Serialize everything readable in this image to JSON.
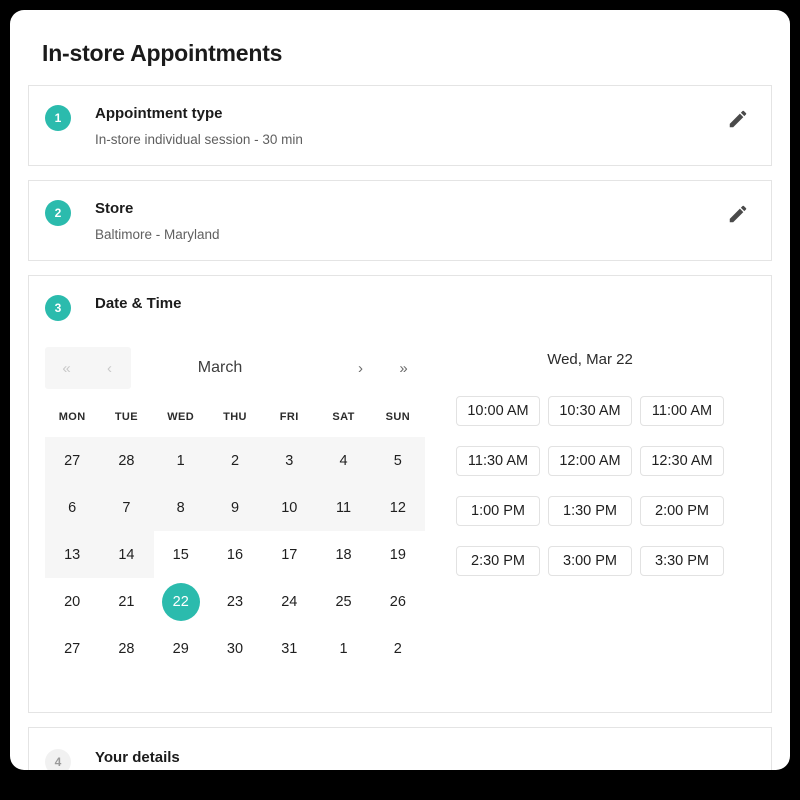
{
  "page": {
    "title": "In-store Appointments"
  },
  "steps": [
    {
      "number": "1",
      "label": "Appointment type",
      "value": "In-store individual session - 30 min",
      "edit_icon": "pencil-icon"
    },
    {
      "number": "2",
      "label": "Store",
      "value": "Baltimore - Maryland",
      "edit_icon": "pencil-icon"
    },
    {
      "number": "3",
      "label": "Date & Time"
    },
    {
      "number": "4",
      "label": "Your details"
    }
  ],
  "calendar": {
    "month": "March",
    "nav": {
      "first": "«",
      "prev": "‹",
      "next": "›",
      "last": "»"
    },
    "weekdays": [
      "MON",
      "TUE",
      "WED",
      "THU",
      "FRI",
      "SAT",
      "SUN"
    ],
    "selected_day": "22",
    "weeks": [
      [
        {
          "d": "27",
          "state": "past"
        },
        {
          "d": "28",
          "state": "past"
        },
        {
          "d": "1",
          "state": "past"
        },
        {
          "d": "2",
          "state": "past"
        },
        {
          "d": "3",
          "state": "past"
        },
        {
          "d": "4",
          "state": "past"
        },
        {
          "d": "5",
          "state": "past"
        }
      ],
      [
        {
          "d": "6",
          "state": "past"
        },
        {
          "d": "7",
          "state": "past"
        },
        {
          "d": "8",
          "state": "past"
        },
        {
          "d": "9",
          "state": "past"
        },
        {
          "d": "10",
          "state": "past"
        },
        {
          "d": "11",
          "state": "past"
        },
        {
          "d": "12",
          "state": "past"
        }
      ],
      [
        {
          "d": "13",
          "state": "past"
        },
        {
          "d": "14",
          "state": "past"
        },
        {
          "d": "15",
          "state": "enabled"
        },
        {
          "d": "16",
          "state": "enabled"
        },
        {
          "d": "17",
          "state": "enabled"
        },
        {
          "d": "18",
          "state": "enabled"
        },
        {
          "d": "19",
          "state": "enabled"
        }
      ],
      [
        {
          "d": "20",
          "state": "enabled"
        },
        {
          "d": "21",
          "state": "enabled"
        },
        {
          "d": "22",
          "state": "selected"
        },
        {
          "d": "23",
          "state": "enabled"
        },
        {
          "d": "24",
          "state": "enabled"
        },
        {
          "d": "25",
          "state": "enabled"
        },
        {
          "d": "26",
          "state": "enabled"
        }
      ],
      [
        {
          "d": "27",
          "state": "enabled"
        },
        {
          "d": "28",
          "state": "enabled"
        },
        {
          "d": "29",
          "state": "enabled"
        },
        {
          "d": "30",
          "state": "enabled"
        },
        {
          "d": "31",
          "state": "enabled"
        },
        {
          "d": "1",
          "state": "other-month"
        },
        {
          "d": "2",
          "state": "other-month"
        }
      ]
    ]
  },
  "slots": {
    "heading": "Wed, Mar 22",
    "times": [
      "10:00 AM",
      "10:30 AM",
      "11:00 AM",
      "11:30 AM",
      "12:00 AM",
      "12:30 AM",
      "1:00 PM",
      "1:30 PM",
      "2:00 PM",
      "2:30 PM",
      "3:00 PM",
      "3:30 PM"
    ]
  },
  "colors": {
    "accent": "#2bbbad",
    "page_background": "#000000",
    "card_background": "#ffffff",
    "border": "#e4e4e4",
    "disabled_text": "#c2c2c2",
    "past_cell_background": "#f6f6f6"
  }
}
